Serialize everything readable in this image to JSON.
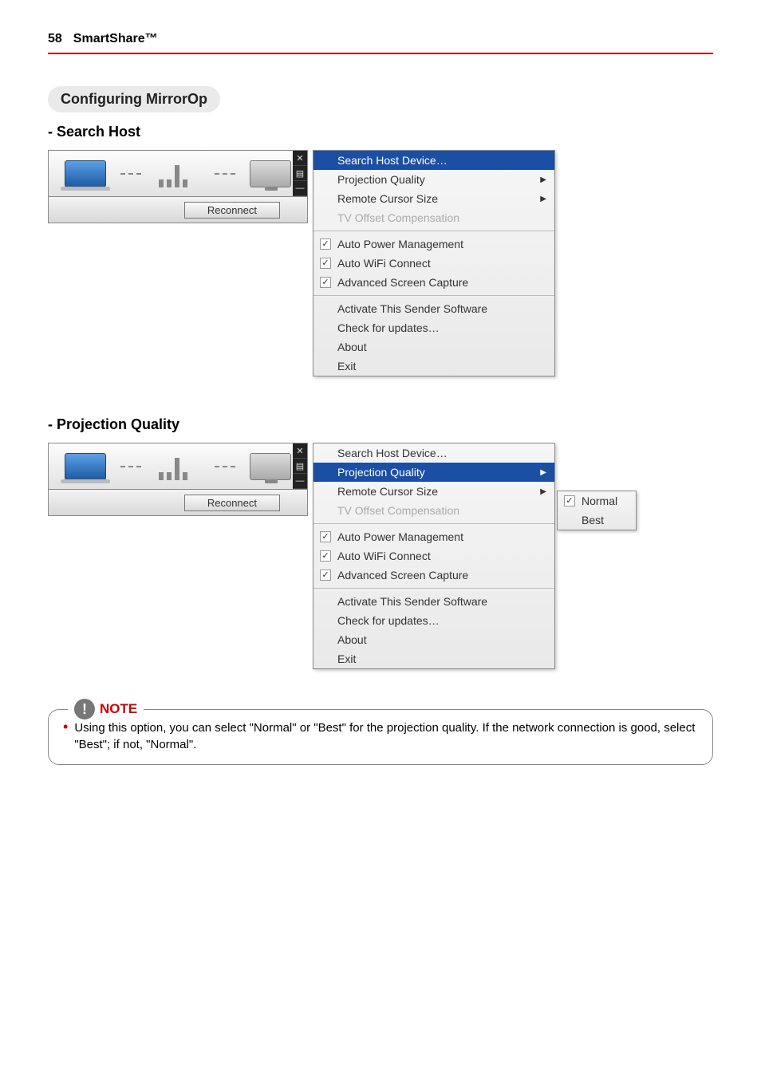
{
  "header": {
    "page_num": "58",
    "doc_title": "SmartShare™"
  },
  "section": {
    "pill_title": "Configuring MirrorOp",
    "sub1": "- Search Host",
    "sub2": "- Projection Quality"
  },
  "sender": {
    "reconnect": "Reconnect"
  },
  "controls": {
    "close": "✕",
    "menu": "▤",
    "min": "—"
  },
  "menu": {
    "search_host": "Search Host Device…",
    "projection_quality": "Projection Quality",
    "remote_cursor": "Remote Cursor Size",
    "tv_offset": "TV Offset Compensation",
    "auto_power": "Auto Power Management",
    "auto_wifi": "Auto WiFi Connect",
    "adv_capture": "Advanced Screen Capture",
    "activate": "Activate This Sender Software",
    "check_updates": "Check for updates…",
    "about": "About",
    "exit": "Exit",
    "arrow": "▶"
  },
  "submenu": {
    "normal": "Normal",
    "best": "Best",
    "check": "✓"
  },
  "note": {
    "title": "NOTE",
    "body": "Using this option, you can select \"Normal\" or \"Best\" for the projection quality. If the network connection is good, select \"Best\"; if not, \"Normal\"."
  }
}
